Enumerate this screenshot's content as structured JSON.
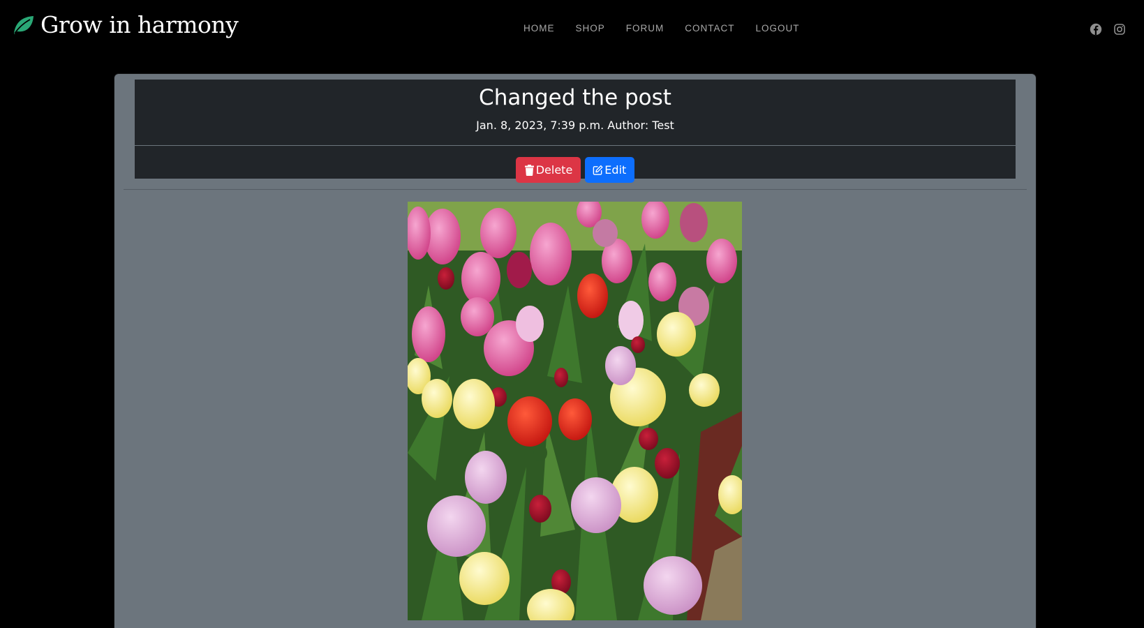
{
  "navbar": {
    "brand": "Grow in harmony",
    "brand_icon": "leaf-icon",
    "brand_color": "#2aa876",
    "links": [
      {
        "label": "HOME"
      },
      {
        "label": "SHOP"
      },
      {
        "label": "FORUM"
      },
      {
        "label": "CONTACT"
      },
      {
        "label": "LOGOUT"
      }
    ],
    "social": [
      {
        "icon": "facebook-icon"
      },
      {
        "icon": "instagram-icon"
      }
    ]
  },
  "post": {
    "title": "Changed the post",
    "meta": "Jan. 8, 2023, 7:39 p.m. Author: Test",
    "delete_label": "Delete",
    "delete_icon": "trash-icon",
    "delete_color": "#dc3545",
    "edit_label": "Edit",
    "edit_icon": "edit-icon",
    "edit_color": "#0d6efd",
    "image_alt": "tulips"
  }
}
